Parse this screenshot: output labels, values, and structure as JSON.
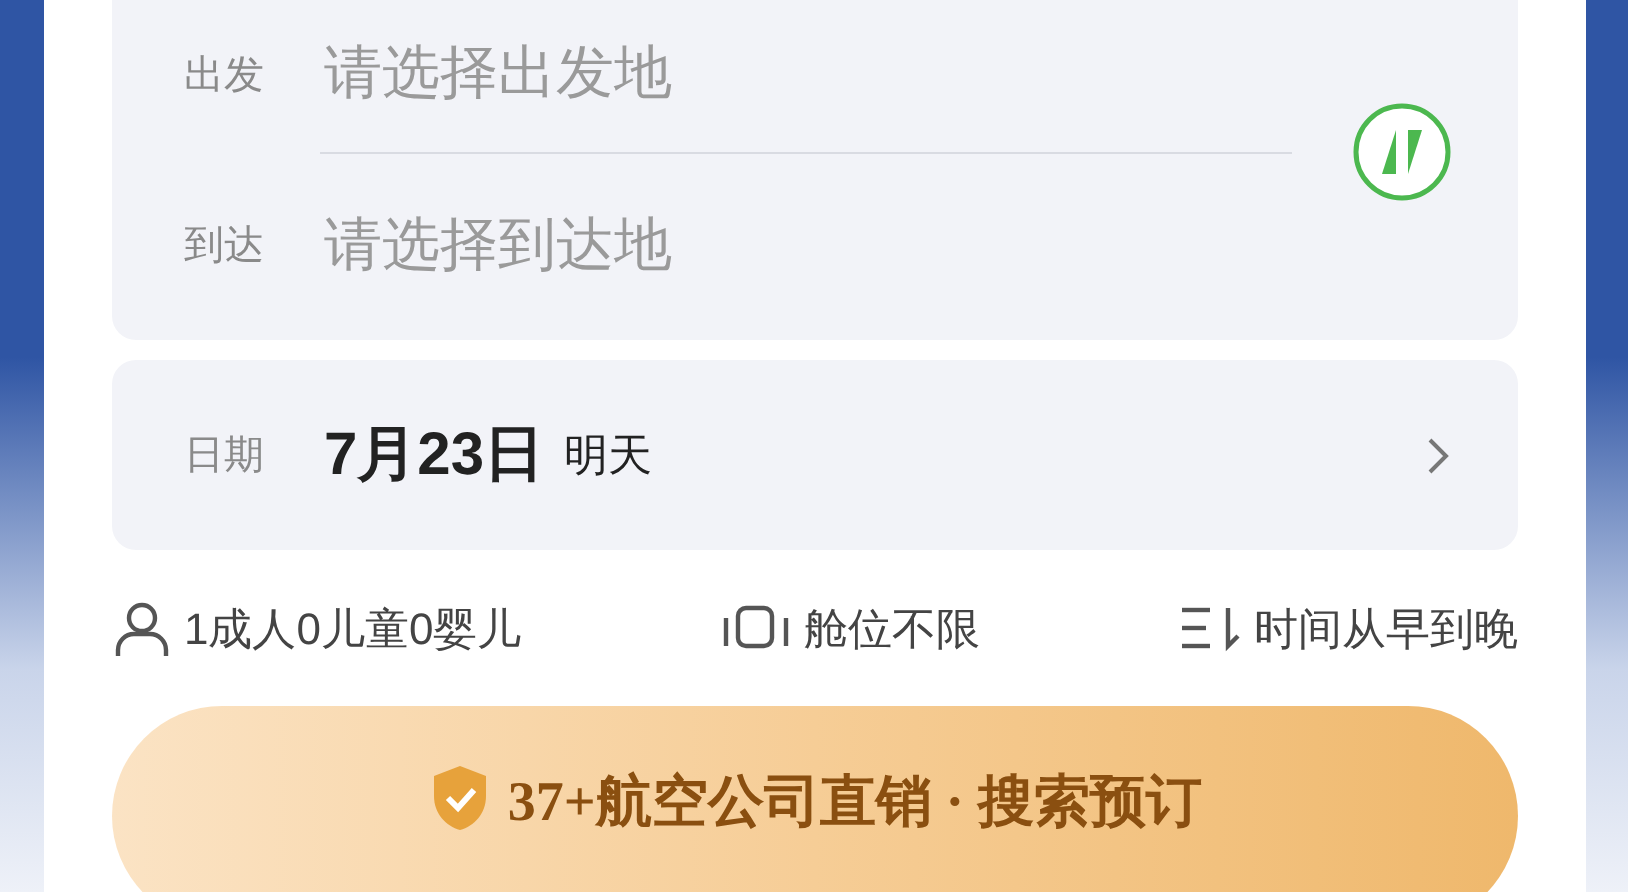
{
  "route": {
    "departure": {
      "label": "出发",
      "placeholder": "请选择出发地"
    },
    "arrival": {
      "label": "到达",
      "placeholder": "请选择到达地"
    }
  },
  "date": {
    "label": "日期",
    "value": "7月23日",
    "day": "明天"
  },
  "options": [
    {
      "kind": "passengers",
      "text": "1成人0儿童0婴儿"
    },
    {
      "kind": "cabin",
      "text": "舱位不限"
    },
    {
      "kind": "sort",
      "text": "时间从早到晚"
    }
  ],
  "search_button": {
    "text": "37+航空公司直销 · 搜索预订"
  }
}
